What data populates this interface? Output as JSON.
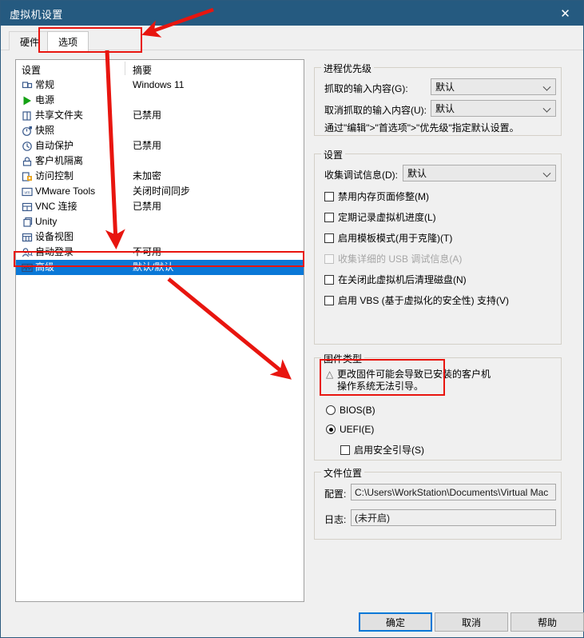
{
  "window": {
    "title": "虚拟机设置",
    "close_label": "✕"
  },
  "tabs": [
    {
      "label": "硬件",
      "active": false
    },
    {
      "label": "选项",
      "active": true
    }
  ],
  "device_list": {
    "header_setting": "设置",
    "header_summary": "摘要",
    "rows": [
      {
        "icon": "general-icon",
        "label": "常规",
        "summary": "Windows 11",
        "selected": false
      },
      {
        "icon": "power-icon",
        "label": "电源",
        "summary": "",
        "selected": false
      },
      {
        "icon": "shared-folder-icon",
        "label": "共享文件夹",
        "summary": "已禁用",
        "selected": false
      },
      {
        "icon": "snapshot-icon",
        "label": "快照",
        "summary": "",
        "selected": false
      },
      {
        "icon": "autoprotect-icon",
        "label": "自动保护",
        "summary": "已禁用",
        "selected": false
      },
      {
        "icon": "guest-isolation-icon",
        "label": "客户机隔离",
        "summary": "",
        "selected": false
      },
      {
        "icon": "access-control-icon",
        "label": "访问控制",
        "summary": "未加密",
        "selected": false
      },
      {
        "icon": "vmware-tools-icon",
        "label": "VMware Tools",
        "summary": "关闭时间同步",
        "selected": false
      },
      {
        "icon": "vnc-icon",
        "label": "VNC 连接",
        "summary": "已禁用",
        "selected": false
      },
      {
        "icon": "unity-icon",
        "label": "Unity",
        "summary": "",
        "selected": false
      },
      {
        "icon": "device-view-icon",
        "label": "设备视图",
        "summary": "",
        "selected": false
      },
      {
        "icon": "autologon-icon",
        "label": "自动登录",
        "summary": "不可用",
        "selected": false
      },
      {
        "icon": "advanced-icon",
        "label": "高级",
        "summary": "默认/默认",
        "selected": true
      }
    ]
  },
  "process_priority": {
    "group_title": "进程优先级",
    "grab_label": "抓取的输入内容(G):",
    "grab_value": "默认",
    "ungrab_label": "取消抓取的输入内容(U):",
    "ungrab_value": "默认",
    "hint": "通过\"编辑\">\"首选项\">\"优先级\"指定默认设置。"
  },
  "settings": {
    "group_title": "设置",
    "debug_label": "收集调试信息(D):",
    "debug_value": "默认",
    "checkboxes": [
      {
        "label": "禁用内存页面修整(M)",
        "checked": false,
        "disabled": false
      },
      {
        "label": "定期记录虚拟机进度(L)",
        "checked": false,
        "disabled": false
      },
      {
        "label": "启用模板模式(用于克隆)(T)",
        "checked": false,
        "disabled": false
      },
      {
        "label": "收集详细的 USB 调试信息(A)",
        "checked": false,
        "disabled": true
      },
      {
        "label": "在关闭此虚拟机后清理磁盘(N)",
        "checked": false,
        "disabled": false
      },
      {
        "label": "启用 VBS (基于虚拟化的安全性) 支持(V)",
        "checked": false,
        "disabled": false
      }
    ]
  },
  "firmware": {
    "group_title": "固件类型",
    "warning_icon": "warning-triangle-icon",
    "warning_line1": "更改固件可能会导致已安装的客户机",
    "warning_line2": "操作系统无法引导。",
    "options": [
      {
        "label": "BIOS(B)",
        "checked": false
      },
      {
        "label": "UEFI(E)",
        "checked": true
      }
    ],
    "secure_boot_label": "启用安全引导(S)",
    "secure_boot_checked": false
  },
  "file_location": {
    "group_title": "文件位置",
    "config_label": "配置:",
    "config_value": "C:\\Users\\WorkStation\\Documents\\Virtual Mac",
    "log_label": "日志:",
    "log_value": "(未开启)"
  },
  "buttons": {
    "ok": "确定",
    "cancel": "取消",
    "help": "帮助"
  },
  "annotation": {
    "color": "#e8150f"
  }
}
